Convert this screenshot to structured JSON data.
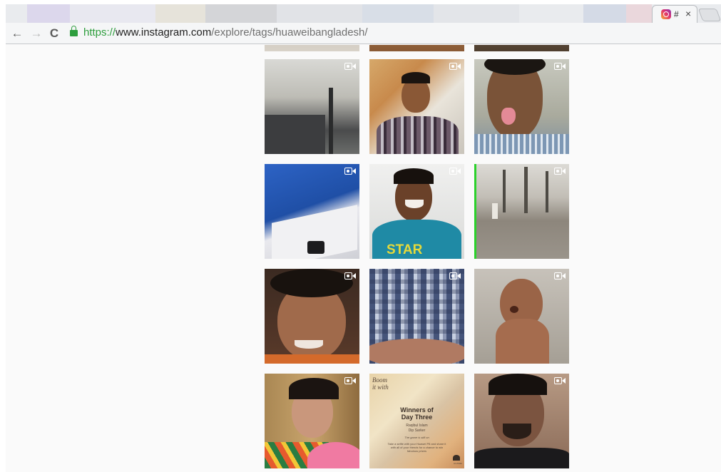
{
  "browser": {
    "tab": {
      "title": "#",
      "favicon": "instagram-icon",
      "close_glyph": "×"
    },
    "nav": {
      "back_glyph": "←",
      "forward_glyph": "→",
      "reload_glyph": "C"
    },
    "address": {
      "scheme": "https://",
      "host": "www.instagram.com",
      "path": "/explore/tags/huaweibangladesh/"
    }
  },
  "grid": {
    "tiles": [
      {
        "label": "office-interior-photo",
        "video": true
      },
      {
        "label": "boy-on-phone-photo",
        "video": true
      },
      {
        "label": "man-tongue-out-photo",
        "video": true
      },
      {
        "label": "desk-papers-photo",
        "video": true
      },
      {
        "label": "smiling-boy-star-shirt-photo",
        "video": true
      },
      {
        "label": "trees-field-photo",
        "video": true
      },
      {
        "label": "man-funny-face-photo",
        "video": true
      },
      {
        "label": "checkered-shirt-photo",
        "video": true
      },
      {
        "label": "child-photo",
        "video": true
      },
      {
        "label": "woman-selfie-photo",
        "video": true
      },
      {
        "label": "huawei-promo-post",
        "video": false
      },
      {
        "label": "man-selfie-photo",
        "video": true
      }
    ],
    "promo": {
      "tag_line_1": "Boom",
      "tag_line_2": "it with",
      "headline_1": "Winners of",
      "headline_2": "Day Three",
      "names_1": "Raqibul Islam",
      "names_2": "Dip Sarker",
      "note": "The game is still on",
      "body_1": "Take a selfie with your Huawei P8 and share it",
      "body_2": "with all of your friends for a chance to win",
      "body_3": "fabulous prizes",
      "brand": "HUAWEI"
    }
  }
}
